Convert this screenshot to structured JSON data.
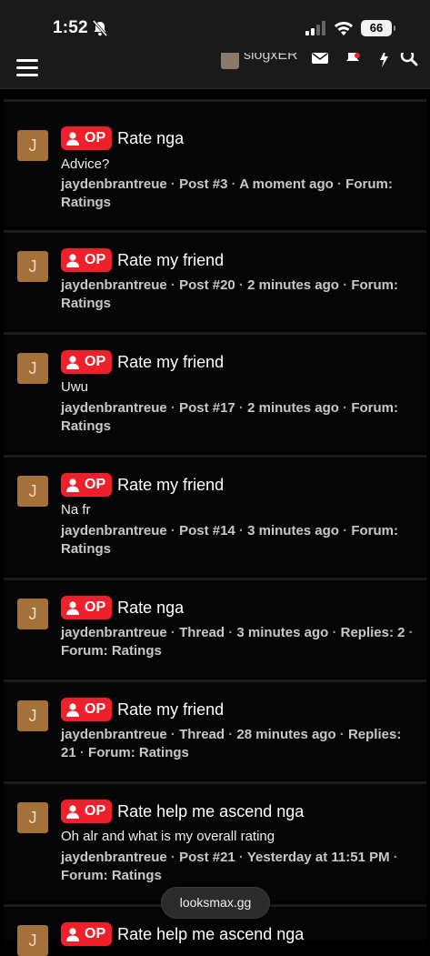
{
  "status_bar": {
    "time": "1:52",
    "battery": "66"
  },
  "nav": {
    "username": "slogxER"
  },
  "items": [
    {
      "title": "Rate nga",
      "snippet": "Advice?",
      "author": "jaydenbrantreue",
      "kind": "Post #3",
      "time": "A moment ago",
      "extra": "",
      "forum": "Forum: Ratings"
    },
    {
      "title": "Rate my friend",
      "snippet": "",
      "author": "jaydenbrantreue",
      "kind": "Post #20",
      "time": "2 minutes ago",
      "extra": "",
      "forum": "Forum: Ratings"
    },
    {
      "title": "Rate my friend",
      "snippet": "Uwu",
      "author": "jaydenbrantreue",
      "kind": "Post #17",
      "time": "2 minutes ago",
      "extra": "",
      "forum": "Forum: Ratings"
    },
    {
      "title": "Rate my friend",
      "snippet": "Na fr",
      "author": "jaydenbrantreue",
      "kind": "Post #14",
      "time": "3 minutes ago",
      "extra": "",
      "forum": "Forum: Ratings"
    },
    {
      "title": "Rate nga",
      "snippet": "",
      "author": "jaydenbrantreue",
      "kind": "Thread",
      "time": "3 minutes ago",
      "extra": "Replies: 2",
      "forum": "Forum: Ratings"
    },
    {
      "title": "Rate my friend",
      "snippet": "",
      "author": "jaydenbrantreue",
      "kind": "Thread",
      "time": "28 minutes ago",
      "extra": "Replies: 21",
      "forum": "Forum: Ratings"
    },
    {
      "title": "Rate help me ascend nga",
      "snippet": "Oh alr and what is my overall rating",
      "author": "jaydenbrantreue",
      "kind": "Post #21",
      "time": "Yesterday at 11:51 PM",
      "extra": "",
      "forum": "Forum: Ratings"
    },
    {
      "title": "Rate help me ascend nga",
      "snippet": "",
      "author": "",
      "kind": "",
      "time": "",
      "extra": "",
      "forum": ""
    }
  ],
  "common": {
    "avatar_letter": "J",
    "op_label": "OP",
    "sep": " · "
  },
  "browser": {
    "url": "looksmax.gg"
  },
  "colors": {
    "op_badge": "#f0202a",
    "avatar_bg": "#a5713a",
    "background": "#000000"
  }
}
